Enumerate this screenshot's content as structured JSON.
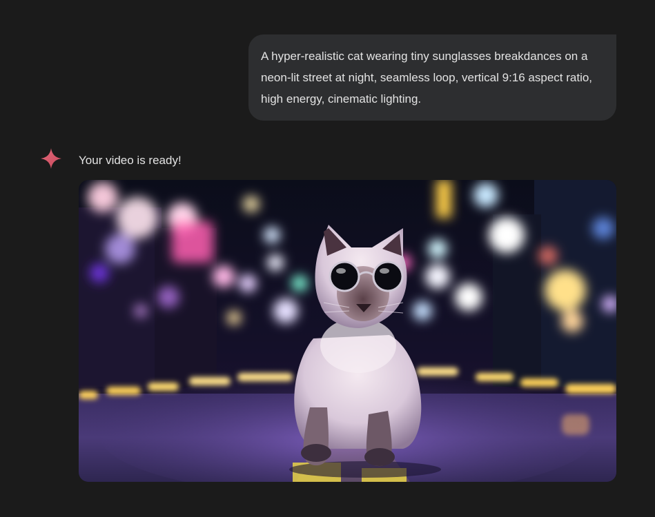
{
  "conversation": {
    "user_message": "A hyper-realistic cat wearing tiny sunglasses breakdances on a neon-lit street at night, seamless loop, vertical 9:16 aspect ratio, high energy, cinematic lighting.",
    "assistant": {
      "icon": "gemini-sparkle-icon",
      "reply_text": "Your video is ready!",
      "video": {
        "subject": "cat-with-sunglasses-neon-street"
      }
    }
  },
  "colors": {
    "background": "#1b1b1b",
    "bubble": "#2d2e30",
    "text": "#e3e3e3",
    "sparkle": "#d95c6b"
  }
}
